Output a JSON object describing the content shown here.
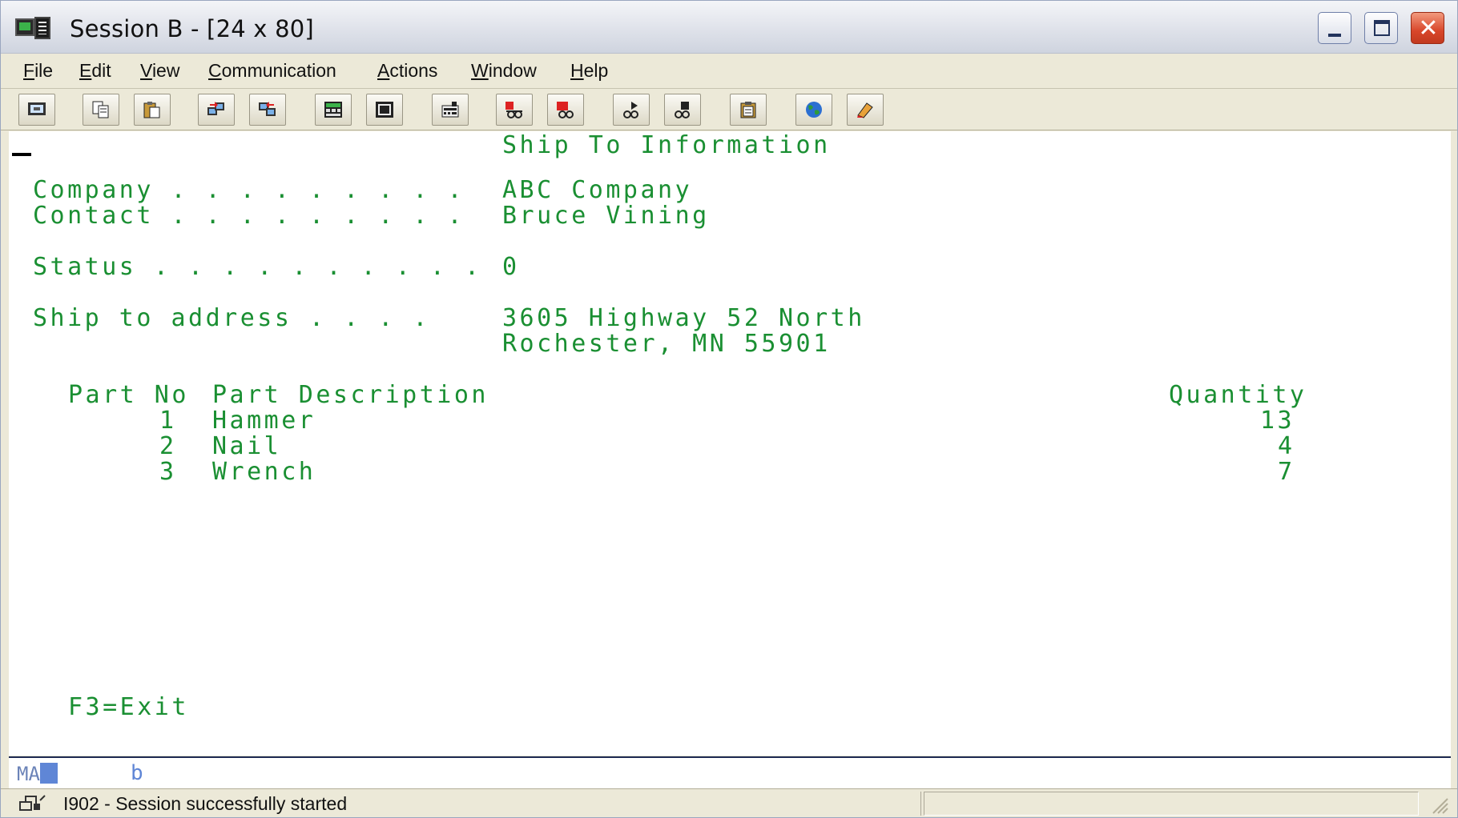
{
  "window": {
    "title": "Session B - [24 x 80]",
    "accent_color": "#d8462a"
  },
  "menu": [
    "File",
    "Edit",
    "View",
    "Communication",
    "Actions",
    "Window",
    "Help"
  ],
  "toolbar_icons": [
    "print-screen-icon",
    "copy-icon",
    "paste-icon",
    "send-icon",
    "receive-icon",
    "display-keypad-icon",
    "keypad-icon",
    "macro-icon",
    "record-macro-icon",
    "stop-macro-icon",
    "play-macro-icon",
    "pause-macro-icon",
    "clipboard-icon",
    "globe-icon",
    "edit-key-icon"
  ],
  "screen": {
    "text_color": "#1a8f32",
    "title": "Ship To Information",
    "company_label": "Company . . . . . . . . .",
    "company_value": "ABC Company",
    "contact_label": "Contact . . . . . . . . .",
    "contact_value": "Bruce Vining",
    "status_label": "Status . . . . . . . . . .",
    "status_value": "0",
    "address_label": "Ship to address . . . .",
    "address_line1": "3605 Highway 52 North",
    "address_line2": "Rochester, MN 55901",
    "columns": {
      "part_no": "Part No",
      "description": "Part Description",
      "quantity": "Quantity"
    },
    "parts": [
      {
        "no": "1",
        "description": "Hammer",
        "quantity": "13"
      },
      {
        "no": "2",
        "description": "Nail",
        "quantity": "4"
      },
      {
        "no": "3",
        "description": "Wrench",
        "quantity": "7"
      }
    ],
    "function_keys": "F3=Exit"
  },
  "oia": {
    "indicator": "MA",
    "session_letter": "b"
  },
  "statusbar": {
    "message": "I902 - Session successfully started"
  }
}
